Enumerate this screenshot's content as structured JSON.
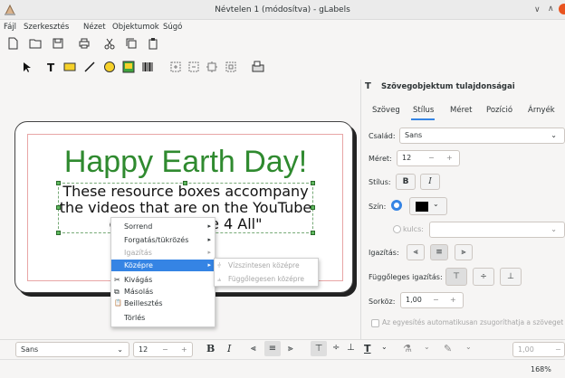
{
  "window": {
    "title": "Névtelen 1 (módosítva) - gLabels",
    "min": "∨",
    "max": "∧"
  },
  "menu": [
    "Fájl",
    "Szerkesztés",
    "Nézet",
    "Objektumok",
    "Súgó"
  ],
  "label": {
    "title": "Happy Earth Day!",
    "body_line1": "These resource boxes accompany",
    "body_line2": "the videos that are on the YouTube",
    "body_line3": "ch               ure 4 All\"",
    "title_color": "#2f8a2f"
  },
  "context_menu": {
    "items": [
      {
        "label": "Sorrend",
        "arrow": "▸"
      },
      {
        "label": "Forgatás/tükrözés",
        "arrow": "▸"
      },
      {
        "label": "Igazítás",
        "arrow": "▸"
      },
      {
        "label": "Középre",
        "arrow": "▸"
      },
      {
        "label": "Kivágás",
        "icon": "✂"
      },
      {
        "label": "Másolás",
        "icon": "⧉"
      },
      {
        "label": "Beillesztés",
        "icon": "📋"
      },
      {
        "label": "Törlés"
      }
    ],
    "submenu": [
      {
        "label": "Vízszintesen középre"
      },
      {
        "label": "Függőlegesen középre"
      }
    ]
  },
  "panel": {
    "title": "Szövegobjektum tulajdonságai",
    "tabs": [
      "Szöveg",
      "Stílus",
      "Méret",
      "Pozíció",
      "Árnyék"
    ],
    "family_label": "Család:",
    "family_value": "Sans",
    "size_label": "Méret:",
    "size_value": "12",
    "style_label": "Stílus:",
    "color_label": "Szín:",
    "key_label": "kulcs:",
    "align_label": "Igazítás:",
    "valign_label": "Függőleges igazítás:",
    "spacing_label": "Sorköz:",
    "spacing_value": "1,00",
    "autoshrink_label": "Az egyesítés automatikusan zsugoríthatja a szöveget",
    "accent": "#3584e4"
  },
  "bottom_bar": {
    "font": "Sans",
    "size": "12",
    "spacing": "1,00"
  },
  "status": {
    "zoom": "168%"
  }
}
